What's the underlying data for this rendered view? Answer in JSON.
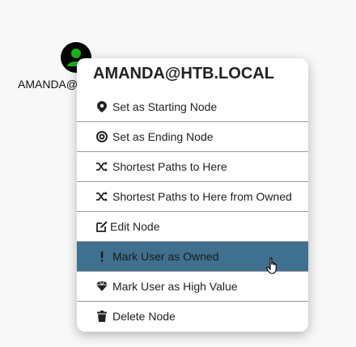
{
  "node": {
    "label": "AMANDA@HTB.LOCAL",
    "icon": "user-icon",
    "color": "#17b317"
  },
  "menu": {
    "title": "AMANDA@HTB.LOCAL",
    "items": [
      {
        "label": "Set as Starting Node",
        "icon": "map-marker-icon"
      },
      {
        "label": "Set as Ending Node",
        "icon": "target-icon"
      },
      {
        "label": "Shortest Paths to Here",
        "icon": "shuffle-icon"
      },
      {
        "label": "Shortest Paths to Here from Owned",
        "icon": "shuffle-icon"
      },
      {
        "label": "Edit Node",
        "icon": "edit-icon"
      },
      {
        "label": "Mark User as Owned",
        "icon": "exclamation-icon",
        "highlighted": true
      },
      {
        "label": "Mark User as High Value",
        "icon": "gem-icon"
      },
      {
        "label": "Delete Node",
        "icon": "trash-icon"
      }
    ],
    "highlight_color": "#40708f"
  }
}
